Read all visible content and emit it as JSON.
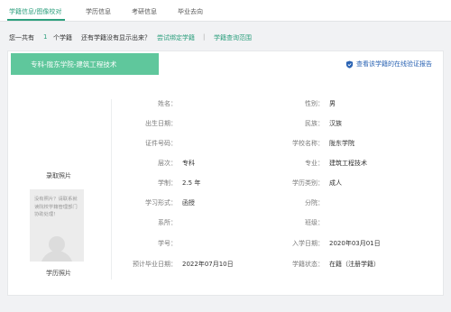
{
  "nav": {
    "tabs": [
      "学籍信息/图像校对",
      "学历信息",
      "考研信息",
      "毕业去向"
    ],
    "active": 0
  },
  "summary": {
    "prefix": "您一共有",
    "count": "1",
    "suffix": "个学籍",
    "question": "还有学籍没有显示出来？",
    "bind_link": "尝试绑定学籍",
    "separator": "|",
    "scope_link": "学籍查询范围"
  },
  "record": {
    "banner": "专科-陇东学院-建筑工程技术",
    "verify_link": "查看该学籍的在线验证报告",
    "photo_top_label": "录取照片",
    "photo_bottom_label": "学历照片",
    "photo_missing_text": "没有照片？请联系就读院校学籍管理部门协助处理！",
    "left_fields": [
      {
        "label": "姓名：",
        "value": ""
      },
      {
        "label": "出生日期：",
        "value": ""
      },
      {
        "label": "证件号码：",
        "value": ""
      },
      {
        "label": "层次：",
        "value": "专科"
      },
      {
        "label": "学制：",
        "value": "2.5 年"
      },
      {
        "label": "学习形式：",
        "value": "函授"
      },
      {
        "label": "系所：",
        "value": ""
      },
      {
        "label": "学号：",
        "value": ""
      },
      {
        "label": "预计毕业日期：",
        "value": "2022年07月10日"
      }
    ],
    "right_fields": [
      {
        "label": "性别：",
        "value": "男"
      },
      {
        "label": "民族：",
        "value": "汉族"
      },
      {
        "label": "学校名称：",
        "value": "陇东学院"
      },
      {
        "label": "专业：",
        "value": "建筑工程技术"
      },
      {
        "label": "学历类别：",
        "value": "成人"
      },
      {
        "label": "分院：",
        "value": ""
      },
      {
        "label": "班级：",
        "value": ""
      },
      {
        "label": "入学日期：",
        "value": "2020年03月01日"
      },
      {
        "label": "学籍状态：",
        "value": "在籍（注册学籍）"
      }
    ]
  },
  "colors": {
    "accent": "#2c9f7d",
    "banner": "#5fc79c",
    "link_blue": "#2a63b3"
  }
}
